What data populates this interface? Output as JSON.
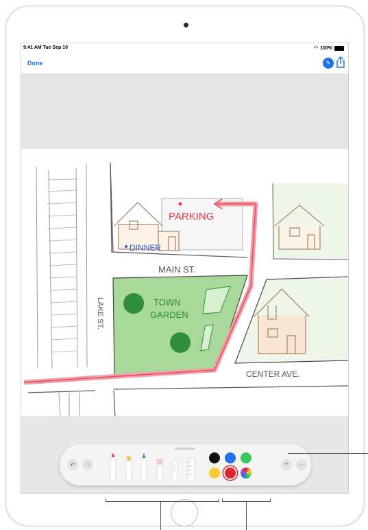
{
  "status_bar": {
    "time": "9:41 AM  Tue Sep 10",
    "battery": "100%"
  },
  "nav": {
    "done_label": "Done",
    "markup_icon": "markup-pen-icon",
    "share_icon": "share-icon"
  },
  "map": {
    "labels": {
      "parking": "PARKING",
      "dinner": "DINNER",
      "main_st": "MAIN ST.",
      "town": "TOWN",
      "garden": "GARDEN",
      "lake_st": "LAKE ST.",
      "center_ave": "CENTER AVE."
    },
    "colors": {
      "route": "#f0a0a8",
      "route_core": "#e8455a",
      "garden": "#9ccf8e",
      "houses": "#b07a50",
      "parking": "#e23b4a",
      "dinner": "#2f62c8"
    }
  },
  "toolbar": {
    "undo_icon": "undo-icon",
    "redo_icon": "redo-icon",
    "tools": [
      {
        "name": "pen-tool",
        "tip": "#e23b4a",
        "label": "97"
      },
      {
        "name": "highlighter-tool",
        "tip": "#f3c23a",
        "label": "80"
      },
      {
        "name": "pencil-tool",
        "tip": "#2b77d6",
        "label": "50"
      },
      {
        "name": "eraser-tool",
        "tip": "#f3c9cc",
        "label": ""
      },
      {
        "name": "lasso-tool",
        "tip": "#cccccc",
        "label": ""
      },
      {
        "name": "ruler-tool",
        "tip": "#dddddd",
        "label": ""
      }
    ],
    "colors": {
      "black": "#111111",
      "blue": "#1f73ea",
      "green": "#35c85a",
      "yellow": "#fbcb2d",
      "red": "#e3242b",
      "multicolor": "color-wheel-icon"
    },
    "plus_label": "+",
    "more_label": "···"
  }
}
